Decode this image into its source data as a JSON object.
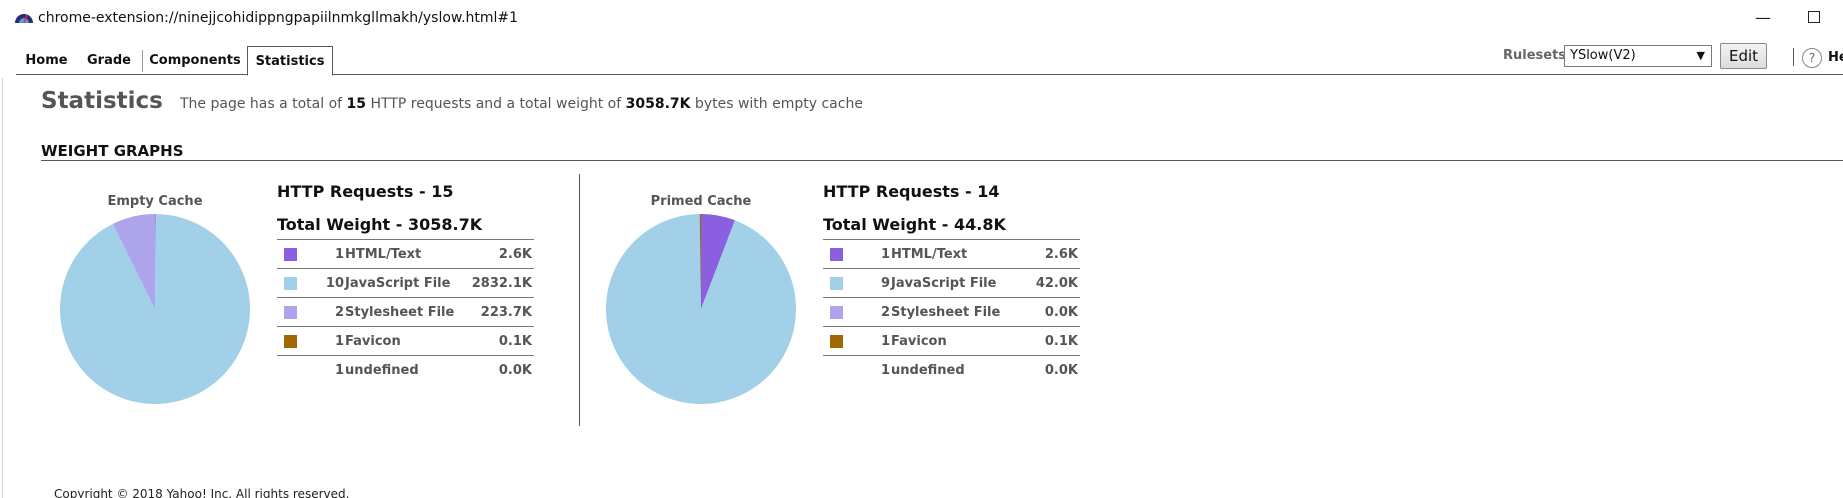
{
  "window": {
    "url": "chrome-extension://ninejjcohidippngpapiilnmkgllmakh/yslow.html#1",
    "minimize": "—"
  },
  "tabs": [
    {
      "label": "Home"
    },
    {
      "label": "Grade"
    },
    {
      "label": "Components"
    },
    {
      "label": "Statistics"
    }
  ],
  "toolbar": {
    "rulesets_label": "Rulesets",
    "rulesets_value": "YSlow(V2)",
    "edit_label": "Edit",
    "help_icon": "?",
    "help_label": "He"
  },
  "page": {
    "heading": "Statistics",
    "summary_pre": "The page has a total of ",
    "total_requests": "15",
    "summary_mid": " HTTP requests and a total weight of ",
    "total_weight": "3058.7K",
    "summary_post": " bytes with empty cache",
    "section_title": "WEIGHT GRAPHS",
    "copyright": "Copyright © 2018 Yahoo! Inc. All rights reserved."
  },
  "colors": {
    "html": "#8a5fe0",
    "javascript": "#a2d0e8",
    "stylesheet": "#ada4ec",
    "favicon": "#a06a00"
  },
  "empty_cache": {
    "label": "Empty Cache",
    "requests_title": "HTTP Requests - 15",
    "weight_title": "Total Weight - 3058.7K",
    "rows": [
      {
        "count": "1",
        "name": "HTML/Text",
        "size": "2.6K",
        "color": "#8a5fe0"
      },
      {
        "count": "10",
        "name": "JavaScript File",
        "size": "2832.1K",
        "color": "#a2d0e8"
      },
      {
        "count": "2",
        "name": "Stylesheet File",
        "size": "223.7K",
        "color": "#ada4ec"
      },
      {
        "count": "1",
        "name": "Favicon",
        "size": "0.1K",
        "color": "#a06a00"
      },
      {
        "count": "1",
        "name": "undefined",
        "size": "0.0K",
        "color": ""
      }
    ],
    "pie_values": [
      2.6,
      2832.1,
      223.7,
      0.1
    ]
  },
  "primed_cache": {
    "label": "Primed Cache",
    "requests_title": "HTTP Requests - 14",
    "weight_title": "Total Weight - 44.8K",
    "rows": [
      {
        "count": "1",
        "name": "HTML/Text",
        "size": "2.6K",
        "color": "#8a5fe0"
      },
      {
        "count": "9",
        "name": "JavaScript File",
        "size": "42.0K",
        "color": "#a2d0e8"
      },
      {
        "count": "2",
        "name": "Stylesheet File",
        "size": "0.0K",
        "color": "#ada4ec"
      },
      {
        "count": "1",
        "name": "Favicon",
        "size": "0.1K",
        "color": "#a06a00"
      },
      {
        "count": "1",
        "name": "undefined",
        "size": "0.0K",
        "color": ""
      }
    ],
    "pie_values": [
      2.6,
      42.0,
      0.0,
      0.1
    ]
  }
}
